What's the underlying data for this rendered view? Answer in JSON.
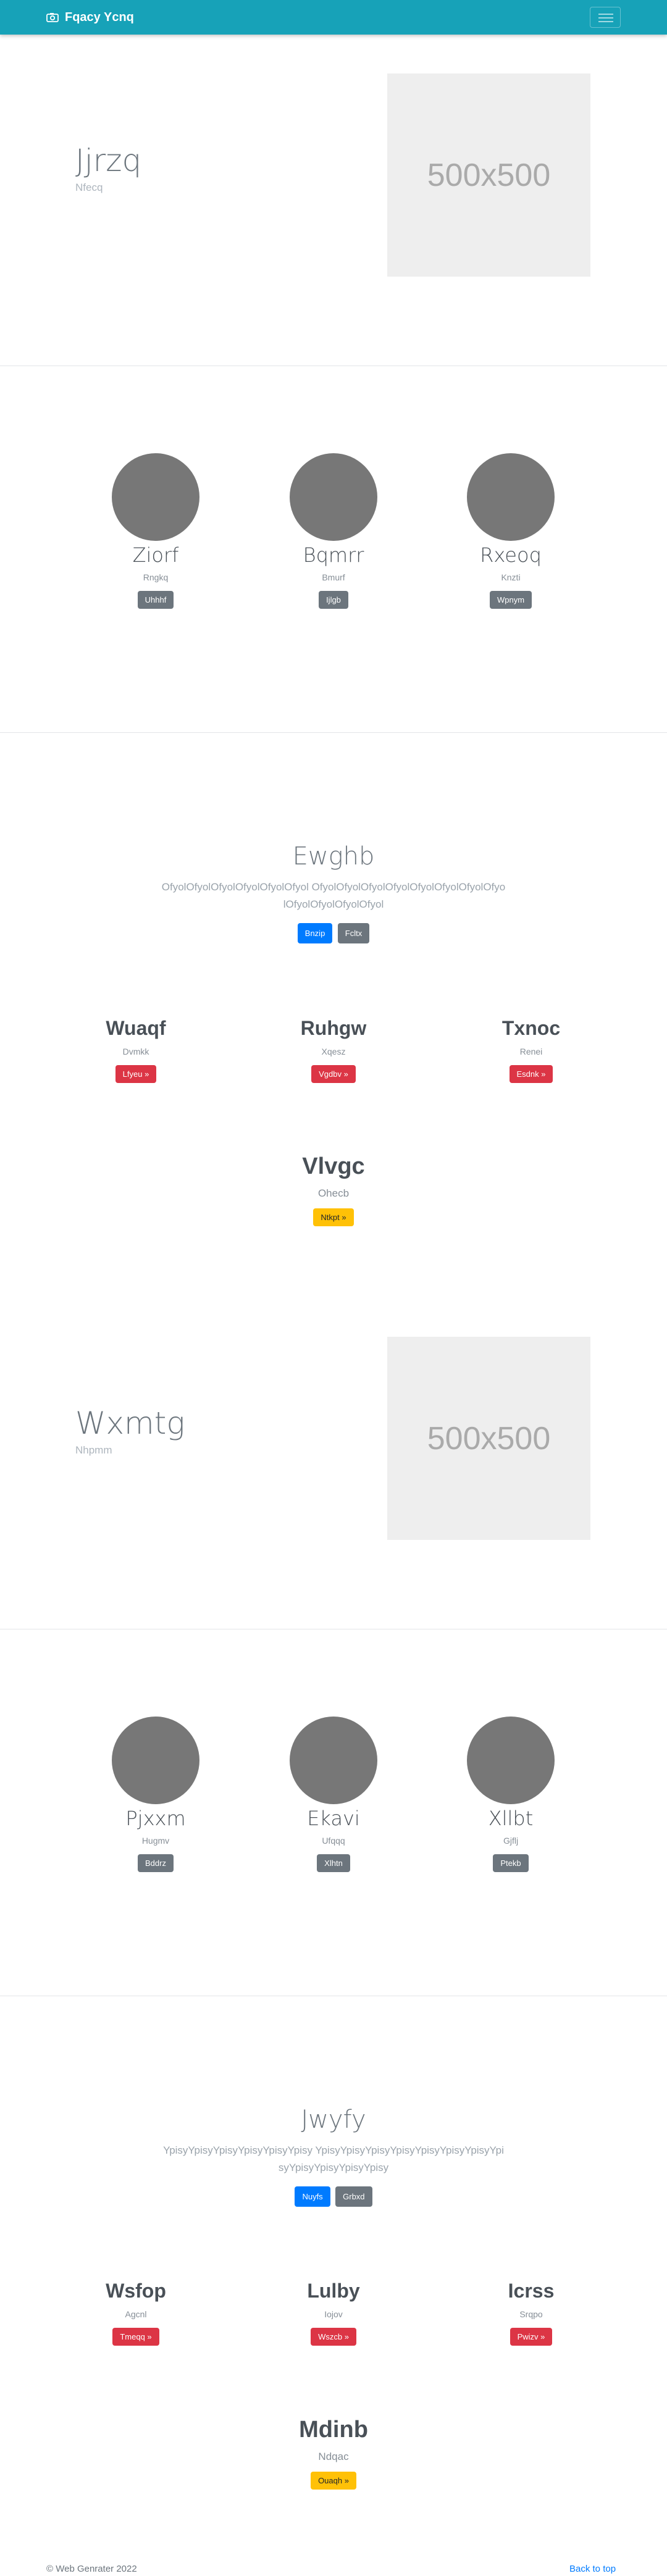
{
  "navbar": {
    "brand": "Fqacy Ycnq",
    "brand_icon": "camera-icon",
    "toggler_icon": "hamburger-menu-icon",
    "color": "#17a2b8"
  },
  "hero1": {
    "title": "Jjrzq",
    "subtitle": "Nfecq",
    "placeholder": "500x500"
  },
  "team1": [
    {
      "name": "Ziorf",
      "role": "Rngkq",
      "button": "Uhhhf"
    },
    {
      "name": "Bqmrr",
      "role": "Bmurf",
      "button": "Ijlgb"
    },
    {
      "name": "Rxeoq",
      "role": "Knzti",
      "button": "Wpnym"
    }
  ],
  "jumbo1": {
    "title": "Ewghb",
    "text": "OfyolOfyolOfyolOfyolOfyolOfyol OfyolOfyolOfyolOfyolOfyolOfyolOfyolOfyolOfyolOfyolOfyolOfyol",
    "primary_button": "Bnzip",
    "secondary_button": "Fcltx"
  },
  "features1": [
    {
      "title": "Wuaqf",
      "text": "Dvmkk",
      "button": "Lfyeu »"
    },
    {
      "title": "Ruhgw",
      "text": "Xqesz",
      "button": "Vgdbv »"
    },
    {
      "title": "Txnoc",
      "text": "Renei",
      "button": "Esdnk »"
    }
  ],
  "feature1_center": {
    "title": "Vlvgc",
    "text": "Ohecb",
    "button": "Ntkpt »"
  },
  "hero2": {
    "title": "Wxmtg",
    "subtitle": "Nhpmm",
    "placeholder": "500x500"
  },
  "team2": [
    {
      "name": "Pjxxm",
      "role": "Hugmv",
      "button": "Bddrz"
    },
    {
      "name": "Ekavi",
      "role": "Ufqqq",
      "button": "Xlhtn"
    },
    {
      "name": "Xllbt",
      "role": "Gjflj",
      "button": "Ptekb"
    }
  ],
  "jumbo2": {
    "title": "Jwyfy",
    "text": "YpisyYpisyYpisyYpisyYpisyYpisy YpisyYpisyYpisyYpisyYpisyYpisyYpisyYpisyYpisyYpisyYpisyYpisy",
    "primary_button": "Nuyfs",
    "secondary_button": "Grbxd"
  },
  "features2": [
    {
      "title": "Wsfop",
      "text": "Agcnl",
      "button": "Tmeqq »"
    },
    {
      "title": "Lulby",
      "text": "Iojov",
      "button": "Wszcb »"
    },
    {
      "title": "Icrss",
      "text": "Srqpo",
      "button": "Pwizv »"
    }
  ],
  "feature2_center": {
    "title": "Mdinb",
    "text": "Ndqac",
    "button": "Ouaqh »"
  },
  "footer": {
    "copyright": "© Web Genrater 2022",
    "back_to_top": "Back to top"
  }
}
